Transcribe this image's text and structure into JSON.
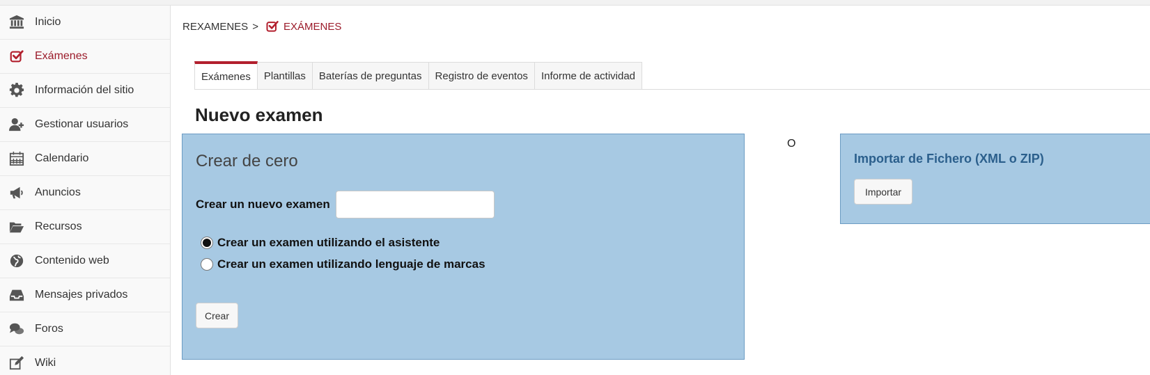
{
  "sidebar": {
    "items": [
      {
        "label": "Inicio",
        "icon": "bank-icon"
      },
      {
        "label": "Exámenes",
        "icon": "checkbox-icon",
        "active": true
      },
      {
        "label": "Información del sitio",
        "icon": "gear-icon"
      },
      {
        "label": "Gestionar usuarios",
        "icon": "user-plus-icon"
      },
      {
        "label": "Calendario",
        "icon": "calendar-icon"
      },
      {
        "label": "Anuncios",
        "icon": "megaphone-icon"
      },
      {
        "label": "Recursos",
        "icon": "folder-open-icon"
      },
      {
        "label": "Contenido web",
        "icon": "globe-icon"
      },
      {
        "label": "Mensajes privados",
        "icon": "inbox-icon"
      },
      {
        "label": "Foros",
        "icon": "comments-icon"
      },
      {
        "label": "Wiki",
        "icon": "edit-icon"
      }
    ]
  },
  "breadcrumb": {
    "site": "REXAMENES",
    "separator": ">",
    "tool": "EXÁMENES"
  },
  "tabs": [
    {
      "label": "Exámenes",
      "active": true
    },
    {
      "label": "Plantillas"
    },
    {
      "label": "Baterías de preguntas"
    },
    {
      "label": "Registro de eventos"
    },
    {
      "label": "Informe de actividad"
    }
  ],
  "page": {
    "title": "Nuevo examen"
  },
  "create_panel": {
    "title": "Crear de cero",
    "field_label": "Crear un nuevo examen",
    "field_value": "",
    "options": [
      {
        "label": "Crear un examen utilizando el asistente",
        "selected": true
      },
      {
        "label": "Crear un examen utilizando lenguaje de marcas",
        "selected": false
      }
    ],
    "button": "Crear"
  },
  "or_label": "O",
  "import_panel": {
    "title": "Importar de Fichero (XML o ZIP)",
    "button": "Importar"
  },
  "colors": {
    "accent": "#b21f2d",
    "panel_bg": "#a7c9e3",
    "import_title": "#2b5f8c"
  }
}
